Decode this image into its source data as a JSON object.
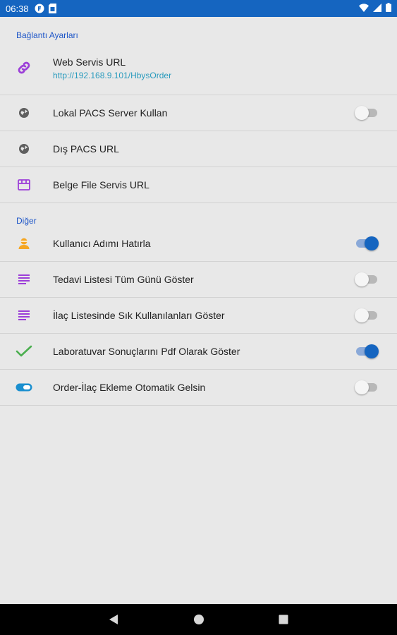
{
  "status_bar": {
    "time": "06:38"
  },
  "sections": [
    {
      "header": "Bağlantı Ayarları",
      "items": [
        {
          "title": "Web Servis URL",
          "subtitle": "http://192.168.9.101/HbysOrder",
          "icon": "link-icon"
        },
        {
          "title": "Lokal PACS Server Kullan",
          "icon": "globe-icon",
          "toggle": false
        },
        {
          "title": "Dış PACS URL",
          "icon": "globe-icon"
        },
        {
          "title": "Belge File Servis URL",
          "icon": "archive-box-icon"
        }
      ]
    },
    {
      "header": "Diğer",
      "items": [
        {
          "title": "Kullanıcı Adımı Hatırla",
          "icon": "user-icon",
          "toggle": true
        },
        {
          "title": "Tedavi Listesi Tüm Günü Göster",
          "icon": "list-icon",
          "toggle": false
        },
        {
          "title": "İlaç Listesinde Sık Kullanılanları Göster",
          "icon": "list-icon",
          "toggle": false
        },
        {
          "title": "Laboratuvar Sonuçlarını Pdf Olarak Göster",
          "icon": "checkmark-icon",
          "toggle": true
        },
        {
          "title": "Order-İlaç Ekleme Otomatik Gelsin",
          "icon": "toggle-pill-icon",
          "toggle": false
        }
      ]
    }
  ],
  "colors": {
    "primary": "#1565c0",
    "section_header": "#1e56c8",
    "subtitle": "#2a9bbd",
    "purple_icon": "#9c3fd8",
    "check_green": "#4caf50",
    "user_orange": "#f5a623"
  }
}
